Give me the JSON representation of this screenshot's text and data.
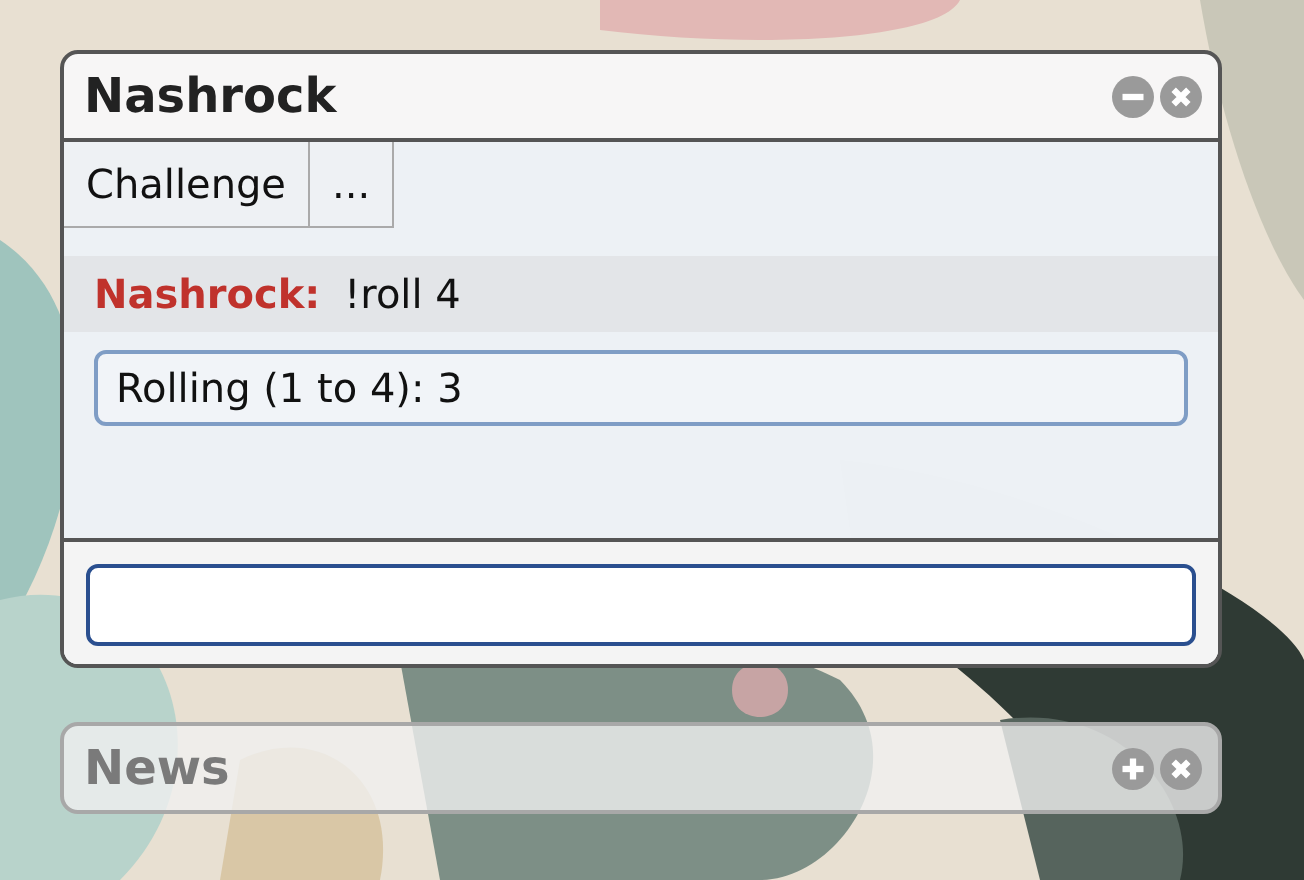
{
  "windows": [
    {
      "title": "Nashrock",
      "expanded": true,
      "buttons": [
        "Challenge",
        "..."
      ],
      "messages": [
        {
          "kind": "chat",
          "sender": "Nashrock:",
          "text": "!roll 4"
        },
        {
          "kind": "system",
          "text": "Rolling (1 to 4): 3"
        }
      ]
    },
    {
      "title": "News",
      "expanded": false
    }
  ]
}
